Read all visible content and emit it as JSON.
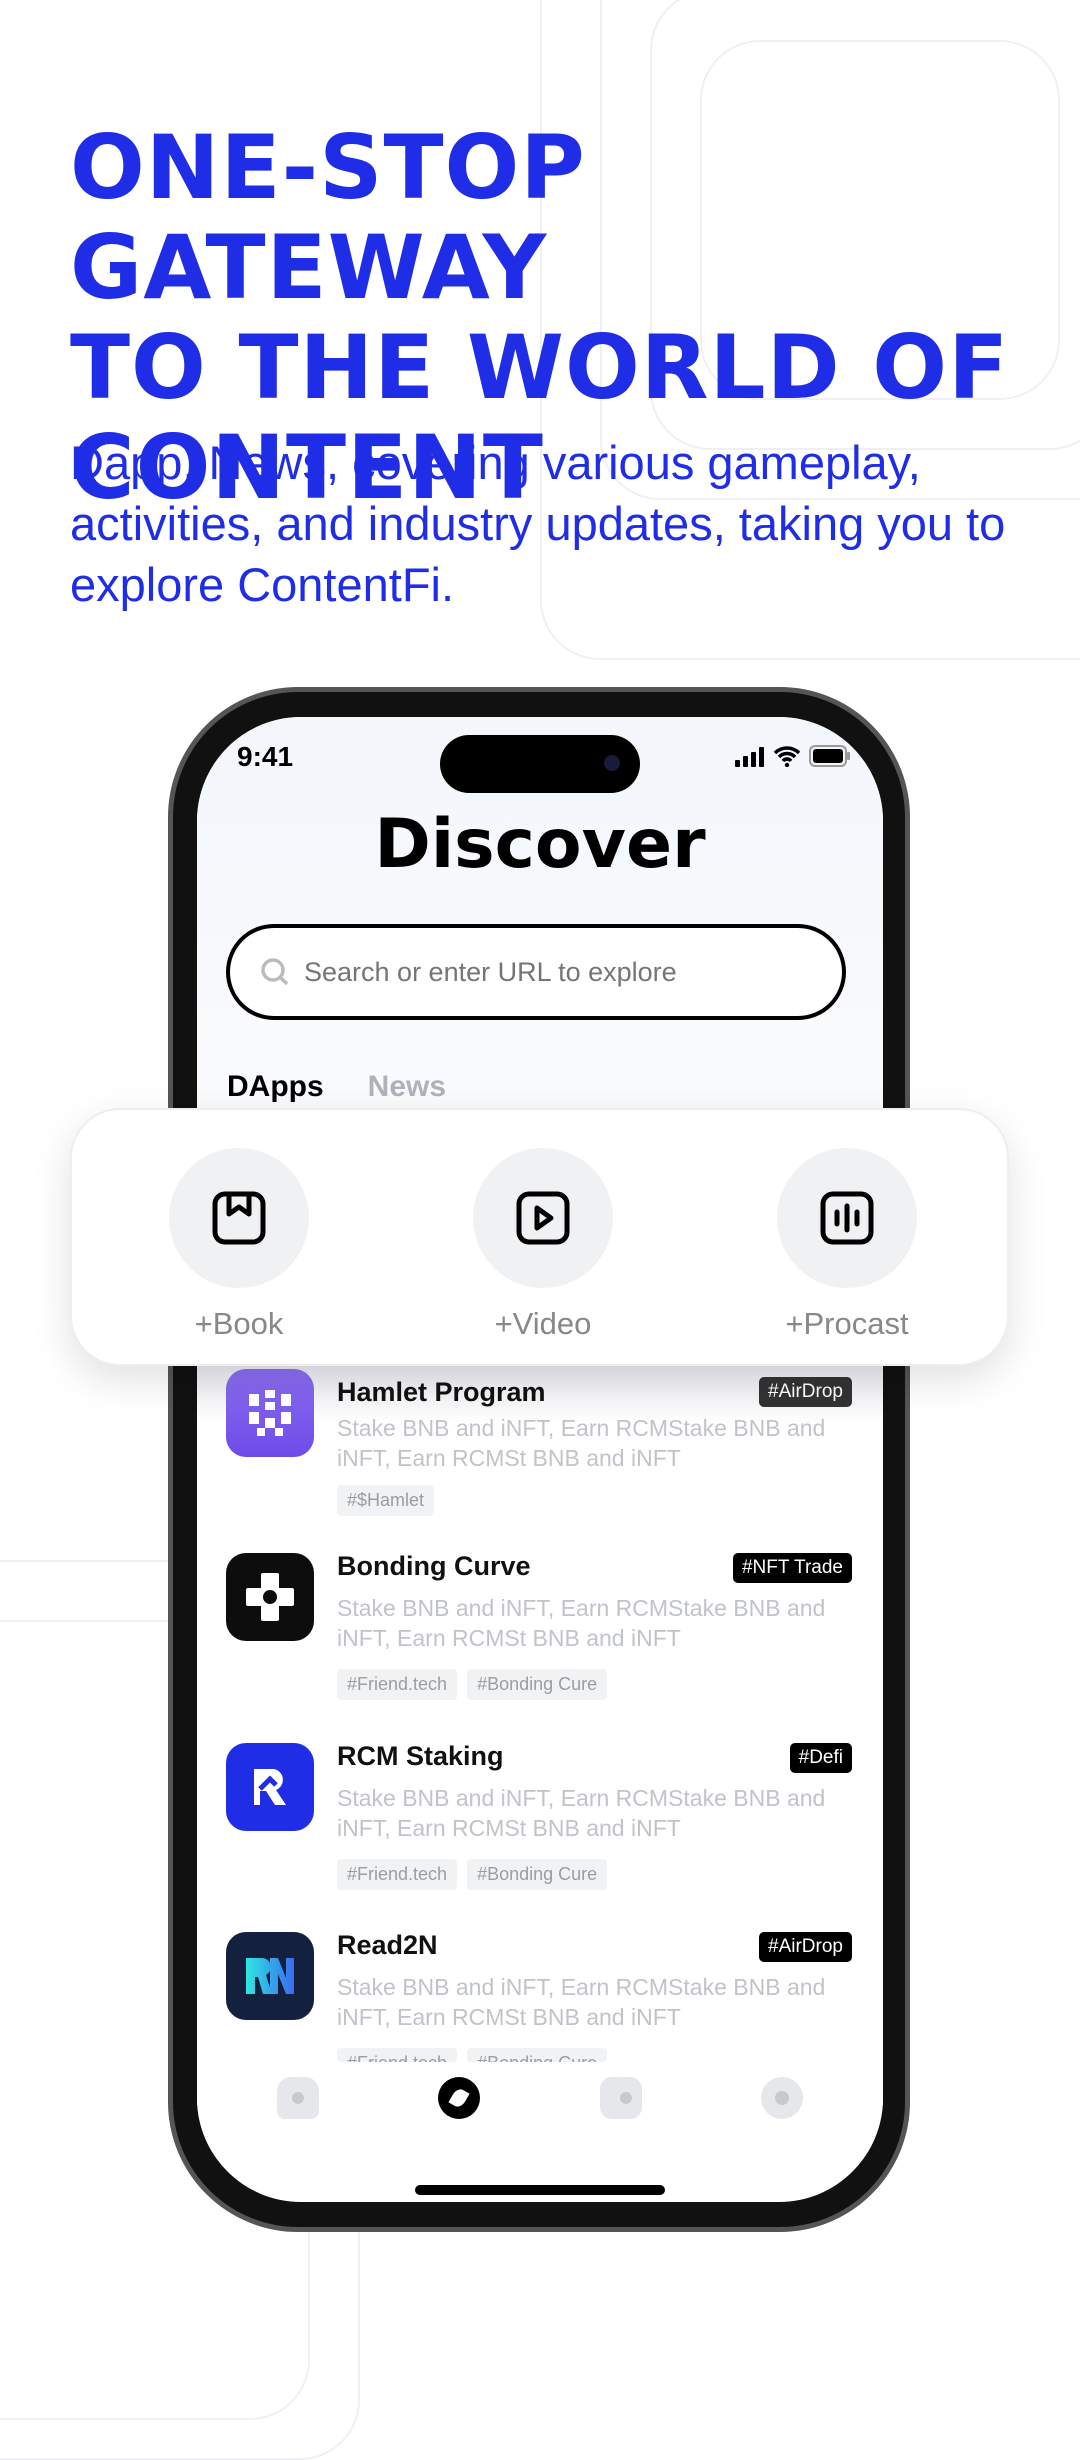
{
  "headline": [
    "ONE-STOP GATEWAY",
    "TO THE WORLD OF",
    "CONTENT"
  ],
  "subtitle": "Dapp, News, covering various gameplay, activities, and industry updates, taking you to explore ContentFi.",
  "accent_color": "#1f2ee6",
  "status_bar": {
    "time": "9:41"
  },
  "screen_title": "Discover",
  "search": {
    "placeholder": "Search or enter URL to explore"
  },
  "tabs": [
    {
      "label": "DApps",
      "active": true
    },
    {
      "label": "News",
      "active": false
    }
  ],
  "actions": [
    {
      "label": "+Book",
      "icon": "bookmark-icon"
    },
    {
      "label": "+Video",
      "icon": "play-icon"
    },
    {
      "label": "+Procast",
      "icon": "audio-icon"
    }
  ],
  "items": [
    {
      "name": "Hamlet Program",
      "badge": "#AirDrop",
      "desc": "Stake BNB and iNFT, Earn RCMStake BNB and iNFT, Earn RCMSt BNB and iNFT",
      "tags": [
        "#$Hamlet"
      ],
      "color": "#7b5cf0"
    },
    {
      "name": "Bonding Curve",
      "badge": "#NFT Trade",
      "desc": "Stake BNB and iNFT, Earn RCMStake BNB and iNFT, Earn RCMSt BNB and iNFT",
      "tags": [
        "#Friend.tech",
        "#Bonding Cure"
      ],
      "color": "#0d0d0d"
    },
    {
      "name": "RCM Staking",
      "badge": "#Defi",
      "desc": "Stake BNB and iNFT, Earn RCMStake BNB and iNFT, Earn RCMSt BNB and iNFT",
      "tags": [
        "#Friend.tech",
        "#Bonding Cure"
      ],
      "color": "#1f2ee6"
    },
    {
      "name": "Read2N",
      "badge": "#AirDrop",
      "desc": "Stake BNB and iNFT, Earn RCMStake BNB and iNFT, Earn RCMSt BNB and iNFT",
      "tags": [
        "#Friend.tech",
        "#Bonding Cure"
      ],
      "color": "#13203f"
    }
  ],
  "bottom_nav": [
    "home-icon",
    "discover-icon",
    "wallet-icon",
    "profile-icon"
  ]
}
